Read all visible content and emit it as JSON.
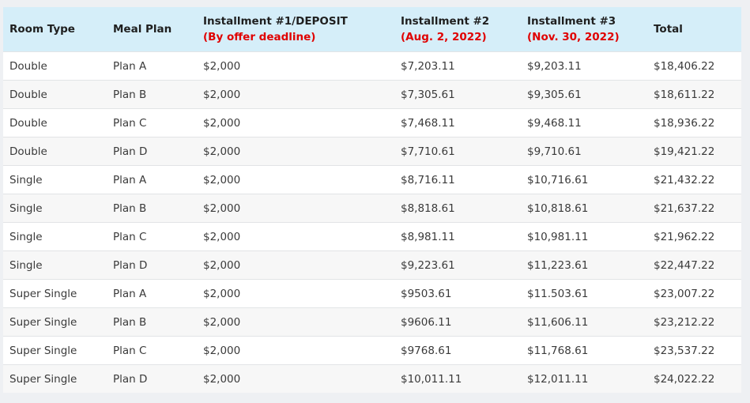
{
  "table": {
    "headers": [
      {
        "label": "Room Type",
        "sub": ""
      },
      {
        "label": "Meal Plan",
        "sub": ""
      },
      {
        "label": "Installment #1/DEPOSIT",
        "sub": "(By offer deadline)"
      },
      {
        "label": "Installment #2",
        "sub": "(Aug. 2, 2022)"
      },
      {
        "label": "Installment #3",
        "sub": "(Nov. 30, 2022)"
      },
      {
        "label": "Total",
        "sub": ""
      }
    ],
    "rows": [
      [
        "Double",
        "Plan A",
        "$2,000",
        "$7,203.11",
        "$9,203.11",
        "$18,406.22"
      ],
      [
        "Double",
        "Plan B",
        "$2,000",
        "$7,305.61",
        "$9,305.61",
        "$18,611.22"
      ],
      [
        "Double",
        "Plan C",
        "$2,000",
        "$7,468.11",
        "$9,468.11",
        "$18,936.22"
      ],
      [
        "Double",
        "Plan D",
        "$2,000",
        "$7,710.61",
        "$9,710.61",
        "$19,421.22"
      ],
      [
        "Single",
        "Plan A",
        "$2,000",
        "$8,716.11",
        "$10,716.61",
        "$21,432.22"
      ],
      [
        "Single",
        "Plan B",
        "$2,000",
        "$8,818.61",
        "$10,818.61",
        "$21,637.22"
      ],
      [
        "Single",
        "Plan C",
        "$2,000",
        "$8,981.11",
        "$10,981.11",
        "$21,962.22"
      ],
      [
        "Single",
        "Plan D",
        "$2,000",
        "$9,223.61",
        "$11,223.61",
        "$22,447.22"
      ],
      [
        "Super Single",
        "Plan A",
        "$2,000",
        "$9503.61",
        "$11.503.61",
        "$23,007.22"
      ],
      [
        "Super Single",
        "Plan B",
        "$2,000",
        "$9606.11",
        "$11,606.11",
        "$23,212.22"
      ],
      [
        "Super Single",
        "Plan C",
        "$2,000",
        "$9768.61",
        "$11,768.61",
        "$23,537.22"
      ],
      [
        "Super Single",
        "Plan D",
        "$2,000",
        "$10,011.11",
        "$12,011.11",
        "$24,022.22"
      ]
    ]
  },
  "colors": {
    "header_bg": "#d5eef9",
    "header_sub_text": "#e00000",
    "row_alt_bg": "#f7f7f7",
    "page_bg": "#eef0f3"
  }
}
